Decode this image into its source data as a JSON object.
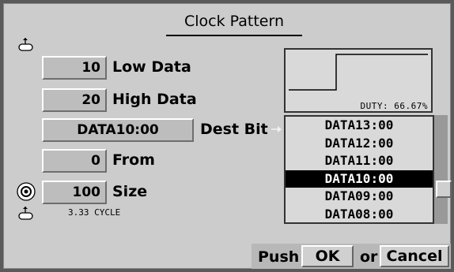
{
  "dialog": {
    "title": "Clock Pattern"
  },
  "fields": {
    "low_data": {
      "value": "10",
      "label": "Low Data"
    },
    "high_data": {
      "value": "20",
      "label": "High Data"
    },
    "dest_bit": {
      "value": "DATA10:00",
      "label": "Dest Bit"
    },
    "from": {
      "value": "0",
      "label": "From"
    },
    "size": {
      "value": "100",
      "label": "Size",
      "cycle_note": "3.33 CYCLE"
    }
  },
  "preview": {
    "duty_text": "DUTY: 66.67%"
  },
  "dest_list": {
    "items": [
      "DATA13:00",
      "DATA12:00",
      "DATA11:00",
      "DATA10:00",
      "DATA09:00",
      "DATA08:00"
    ],
    "selected": "DATA10:00"
  },
  "footer": {
    "push": "Push",
    "ok": "OK",
    "or": "or",
    "cancel": "Cancel"
  },
  "icons": {
    "knob_top": "knob-icon",
    "knob_bottom": "knob-icon",
    "radio": "radio-button-icon",
    "arrow": "arrow-right-icon"
  }
}
